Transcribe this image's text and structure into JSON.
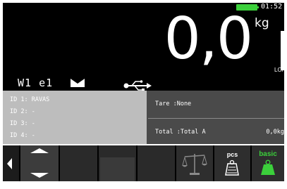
{
  "status": {
    "clock": "01:52",
    "battery_color": "#3bd03b"
  },
  "display": {
    "weight": "0,0",
    "unit": "kg",
    "load_label": "LOA",
    "scale_name": "W1 e1",
    "icons": [
      "net-icon",
      "usb-icon"
    ]
  },
  "ids": [
    "ID 1: RAVAS",
    "ID 2: -",
    "ID 3: -",
    "ID 4: -"
  ],
  "tare": "Tare :None",
  "total": {
    "label": "Total :Total A",
    "value": "0,0kg"
  },
  "keys": {
    "back_icon": "chevron-left-icon",
    "updown_icon": "up-down-arrows-icon",
    "balance_icon": "balance-scale-icon",
    "pcs_label": "pcs",
    "pcs_icon": "counting-weight-icon",
    "basic_label": "basic",
    "basic_icon": "green-weight-icon",
    "accent_green": "#3bd03b"
  }
}
